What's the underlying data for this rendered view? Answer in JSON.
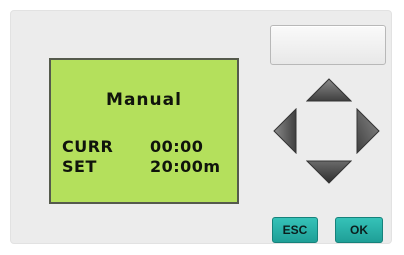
{
  "lcd": {
    "title": "Manual",
    "rows": [
      {
        "label": "CURR",
        "value": "00:00"
      },
      {
        "label": "SET",
        "value": "20:00m"
      }
    ]
  },
  "controls": {
    "esc_label": "ESC",
    "ok_label": "OK",
    "dpad_icons": [
      "arrow-up-icon",
      "arrow-left-icon",
      "arrow-right-icon",
      "arrow-down-icon"
    ]
  },
  "colors": {
    "lcd_background": "#b4e05c",
    "key_accent": "#2bb3aa",
    "dpad_dark": "#4a4a4a"
  }
}
